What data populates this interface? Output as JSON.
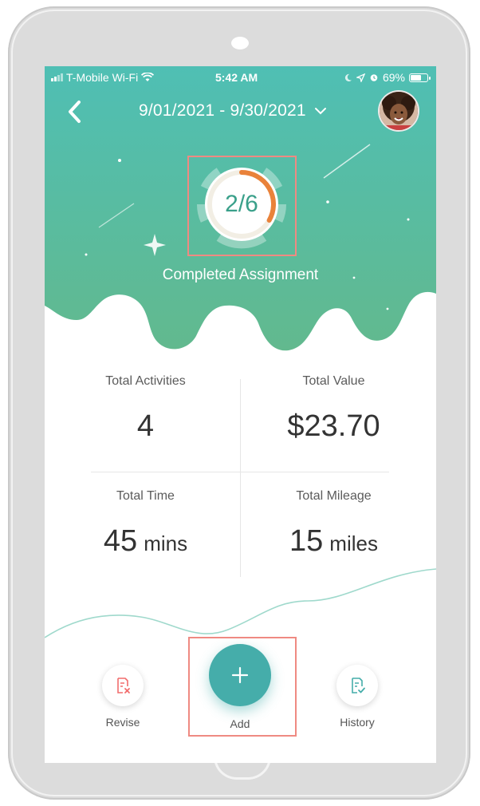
{
  "status_bar": {
    "carrier": "T-Mobile Wi-Fi",
    "time": "5:42 AM",
    "battery": "69%",
    "battery_level": 0.69
  },
  "header": {
    "back_icon": "chevron-left-icon",
    "date_range": "9/01/2021 - 9/30/2021",
    "dropdown_icon": "chevron-down-icon",
    "avatar_icon": "user-avatar"
  },
  "progress": {
    "text": "2/6",
    "completed": 2,
    "total": 6,
    "label": "Completed Assignment"
  },
  "stats": {
    "total_activities": {
      "label": "Total Activities",
      "value": "4"
    },
    "total_value": {
      "label": "Total Value",
      "value": "$23.70"
    },
    "total_time": {
      "label": "Total Time",
      "value": "45",
      "unit": "mins"
    },
    "total_mileage": {
      "label": "Total Mileage",
      "value": "15",
      "unit": "miles"
    }
  },
  "actions": {
    "revise": {
      "label": "Revise",
      "icon": "document-x-icon"
    },
    "add": {
      "label": "Add",
      "icon": "plus-icon"
    },
    "history": {
      "label": "History",
      "icon": "document-check-icon"
    }
  },
  "colors": {
    "header_gradient_top": "#4fbfb4",
    "header_gradient_bottom": "#62b98e",
    "progress_arc": "#e9823a",
    "accent": "#45adaa",
    "revise_icon": "#f26d6d",
    "history_icon": "#45adaa"
  }
}
